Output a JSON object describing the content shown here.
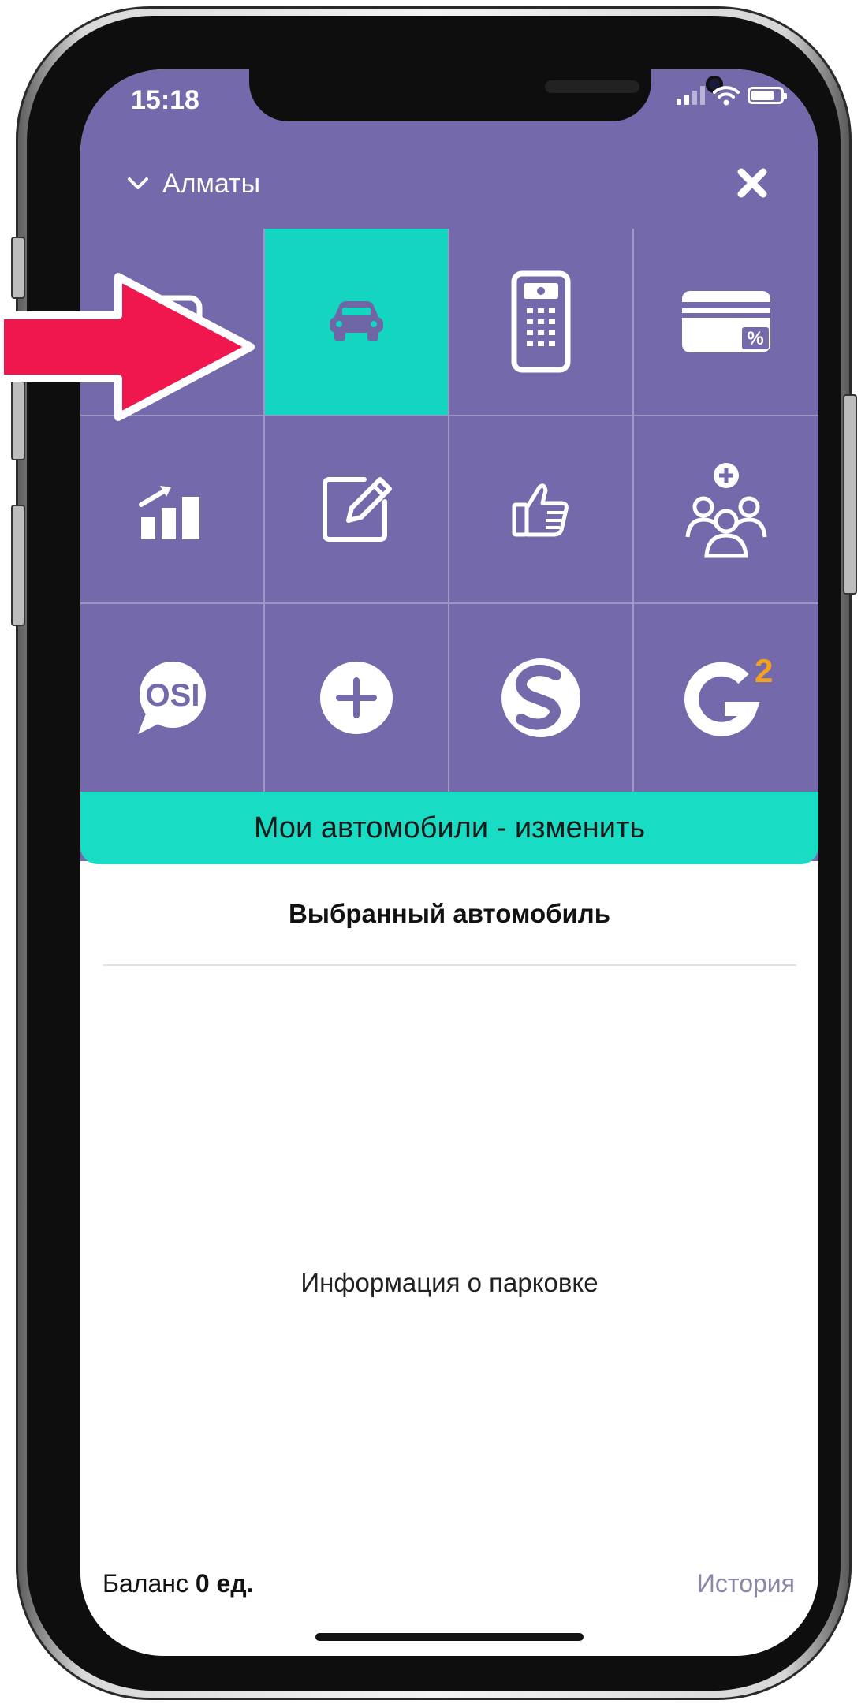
{
  "status_bar": {
    "time": "15:18"
  },
  "header": {
    "city": "Алматы"
  },
  "banner": {
    "label": "Мои автомобили - изменить"
  },
  "selected_car": {
    "title": "Выбранный автомобиль"
  },
  "parking": {
    "info": "Информация о парковке"
  },
  "footer": {
    "balance_label": "Баланс",
    "balance_value": "0 ед.",
    "history_label": "История"
  },
  "grid_icons": {
    "os_badge": "OSI",
    "g_superscript": "2"
  },
  "icons": [
    "chevron-down-icon",
    "close-icon",
    "parking-icon",
    "car-icon",
    "intercom-icon",
    "discount-card-icon",
    "bar-chart-icon",
    "edit-icon",
    "thumbs-up-icon",
    "add-group-icon",
    "osi-chat-icon",
    "plus-circle-icon",
    "s-logo-icon",
    "g2-logo-icon"
  ],
  "colors": {
    "header_bg": "#7369ab",
    "accent_teal": "#19dcc4",
    "arrow": "#f0174f",
    "g2_orange": "#f5a21c"
  }
}
